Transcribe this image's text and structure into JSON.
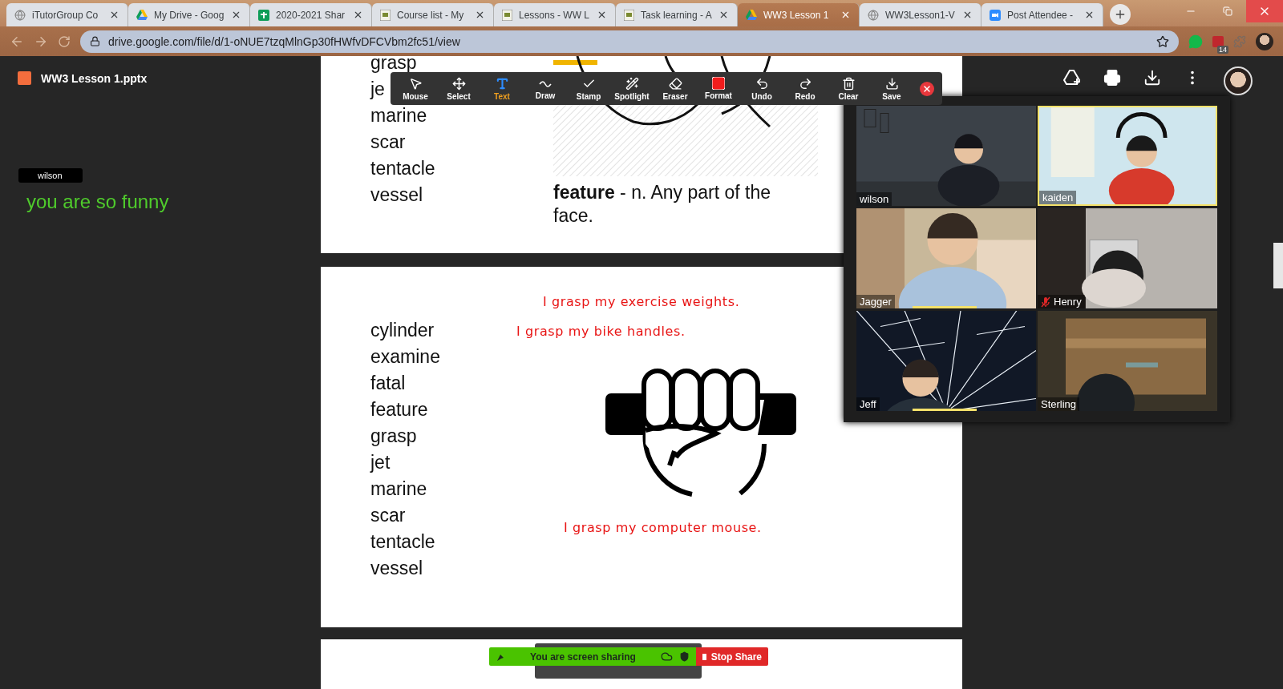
{
  "browser": {
    "tabs": [
      {
        "title": "iTutorGroup Co",
        "selected": false
      },
      {
        "title": "My Drive - Goog",
        "selected": false
      },
      {
        "title": "2020-2021 Shar",
        "selected": false
      },
      {
        "title": "Course list - My",
        "selected": false
      },
      {
        "title": "Lessons - WW L",
        "selected": false
      },
      {
        "title": "Task learning - A",
        "selected": false
      },
      {
        "title": "WW3 Lesson 1",
        "selected": true
      },
      {
        "title": "WW3Lesson1-V",
        "selected": false
      },
      {
        "title": "Post Attendee -",
        "selected": false
      }
    ],
    "address": "drive.google.com/file/d/1-oNUE7tzqMlnGp30fHWfvDFCVbm2fc51/view",
    "extension_badge": "14"
  },
  "viewer": {
    "file_name": "WW3 Lesson 1.pptx"
  },
  "chat": {
    "sender": "wilson",
    "message": "you are so funny"
  },
  "slides": [
    {
      "words": [
        "grasp",
        "je",
        "marine",
        "scar",
        "tentacle",
        "vessel"
      ],
      "definition": "**feature** - n. Any part of the face."
    },
    {
      "words": [
        "cylinder",
        "examine",
        "fatal",
        "feature",
        "grasp",
        "jet",
        "marine",
        "scar",
        "tentacle",
        "vessel"
      ],
      "sentences": [
        "I grasp my exercise weights.",
        "I grasp my bike handles.",
        "I grasp my computer mouse."
      ]
    }
  ],
  "annotation_toolbar": {
    "tools": [
      {
        "label": "Mouse",
        "selected": false
      },
      {
        "label": "Select",
        "selected": false
      },
      {
        "label": "Text",
        "selected": true
      },
      {
        "label": "Draw",
        "selected": false
      },
      {
        "label": "Stamp",
        "selected": false
      },
      {
        "label": "Spotlight",
        "selected": false
      },
      {
        "label": "Eraser",
        "selected": false
      },
      {
        "label": "Format",
        "selected": false
      },
      {
        "label": "Undo",
        "selected": false
      },
      {
        "label": "Redo",
        "selected": false
      },
      {
        "label": "Clear",
        "selected": false
      },
      {
        "label": "Save",
        "selected": false
      }
    ]
  },
  "video_tiles": [
    {
      "name": "wilson",
      "muted": false,
      "active_speaker": false,
      "speaking": false
    },
    {
      "name": "kaiden",
      "muted": false,
      "active_speaker": true,
      "speaking": false
    },
    {
      "name": "Jagger",
      "muted": false,
      "active_speaker": false,
      "speaking": true
    },
    {
      "name": "Henry",
      "muted": true,
      "active_speaker": false,
      "speaking": false
    },
    {
      "name": "Jeff",
      "muted": false,
      "active_speaker": false,
      "speaking": true
    },
    {
      "name": "Sterling",
      "muted": false,
      "active_speaker": false,
      "speaking": false
    }
  ],
  "share_bar": {
    "status": "You are screen sharing",
    "stop_label": "Stop Share"
  }
}
